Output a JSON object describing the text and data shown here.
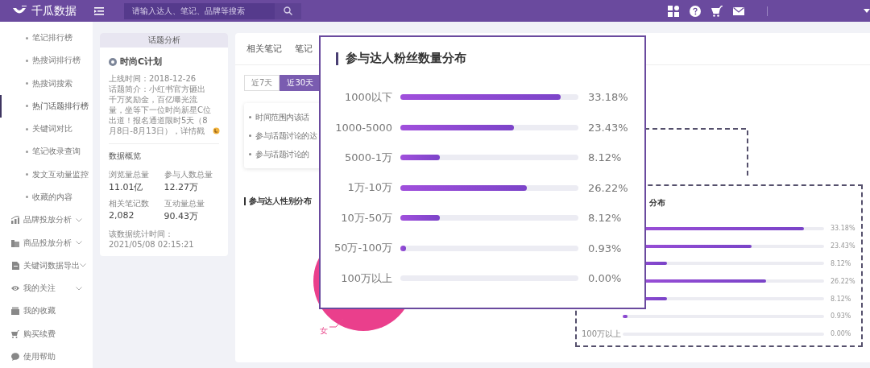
{
  "header": {
    "logo_text": "千瓜数据",
    "search": {
      "placeholder": "请输入达人、笔记、品牌等搜索"
    }
  },
  "sidebar": {
    "items": [
      {
        "kind": "subitem",
        "label": "笔记排行榜",
        "selected": false
      },
      {
        "kind": "subitem",
        "label": "热搜词排行榜",
        "selected": false
      },
      {
        "kind": "subitem",
        "label": "热搜词搜索",
        "selected": false
      },
      {
        "kind": "subitem",
        "label": "热门话题排行榜",
        "selected": true
      },
      {
        "kind": "subitem",
        "label": "关键词对比",
        "selected": false
      },
      {
        "kind": "subitem",
        "label": "笔记收录查询",
        "selected": false
      },
      {
        "kind": "subitem",
        "label": "发文互动量监控",
        "selected": false
      },
      {
        "kind": "subitem",
        "label": "收藏的内容",
        "selected": false
      },
      {
        "kind": "menu",
        "label": "品牌投放分析",
        "selected": false
      },
      {
        "kind": "menu",
        "label": "商品投放分析",
        "selected": false
      },
      {
        "kind": "menu",
        "label": "关键词数据导出",
        "selected": false
      },
      {
        "kind": "menu",
        "label": "我的关注",
        "selected": false
      },
      {
        "kind": "link",
        "label": "我的收藏",
        "selected": false
      },
      {
        "kind": "link",
        "label": "购买续费",
        "selected": false
      },
      {
        "kind": "link",
        "label": "使用帮助",
        "selected": false
      }
    ]
  },
  "topic_card": {
    "header": "话题分析",
    "title": "时尚C计划",
    "online_date": "上线时间：2018-12-26",
    "intro": "话题简介：小红书官方砸出千万奖励金，百亿曝光流量，坐等下一位时尚新星C位出道！报名通道限时5天（8月8日-8月13日），详情戳",
    "overview_title": "数据概览",
    "stats": [
      {
        "label": "浏览量总量",
        "value": "11.01亿"
      },
      {
        "label": "参与人数总量",
        "value": "12.27万"
      },
      {
        "label": "相关笔记数",
        "value": "2,082"
      },
      {
        "label": "互动量总量",
        "value": "90.43万"
      }
    ],
    "footer": "该数据统计时间：2021/05/08 02:15:21"
  },
  "main_panel": {
    "tabs": [
      {
        "label": "相关笔记",
        "selected": false
      },
      {
        "label": "笔记",
        "selected": false
      }
    ],
    "range_buttons": [
      {
        "label": "近7天",
        "selected": false
      },
      {
        "label": "近30天",
        "selected": true
      }
    ],
    "notes": [
      "时间范围内该话",
      "参与话题讨论的达",
      "参与话题讨论的"
    ],
    "gender_section": {
      "title": "参与达人性别分布",
      "pie_label": "女"
    },
    "fan_section": {
      "title": "分布",
      "rows": [
        {
          "level": 0.9,
          "reading": "33.18%"
        },
        {
          "level": 0.64,
          "reading": "23.43%"
        },
        {
          "level": 0.22,
          "reading": "8.12%"
        },
        {
          "level": 0.71,
          "reading": "26.22%"
        },
        {
          "level": 0.22,
          "reading": "8.12%"
        },
        {
          "level": 0.025,
          "reading": "0.93%"
        },
        {
          "label": "100万以上",
          "level": 0,
          "reading": "0.00%"
        }
      ]
    }
  },
  "zoom_callout": {
    "title": "参与达人粉丝数量分布",
    "rows": [
      {
        "label": "1000以下",
        "level": 0.9,
        "reading": "33.18%"
      },
      {
        "label": "1000-5000",
        "level": 0.64,
        "reading": "23.43%"
      },
      {
        "label": "5000-1万",
        "level": 0.22,
        "reading": "8.12%"
      },
      {
        "label": "1万-10万",
        "level": 0.71,
        "reading": "26.22%"
      },
      {
        "label": "10万-50万",
        "level": 0.22,
        "reading": "8.12%"
      },
      {
        "label": "50万-100万",
        "level": 0.025,
        "reading": "0.93%"
      },
      {
        "label": "100万以上",
        "level": 0,
        "reading": "0.00%"
      }
    ]
  }
}
